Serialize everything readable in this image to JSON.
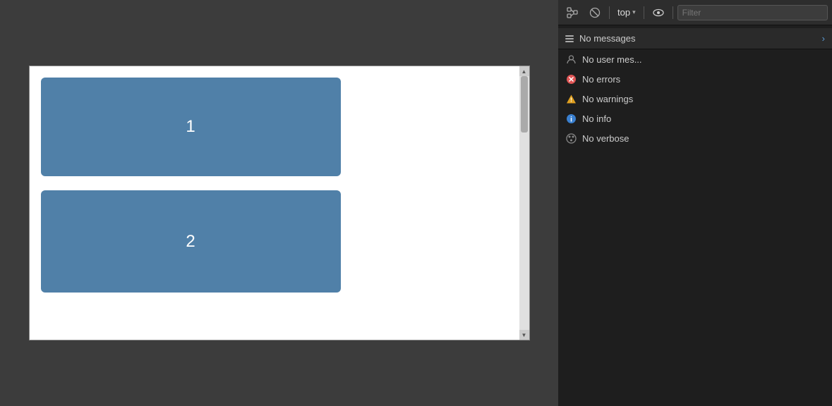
{
  "toolbar": {
    "top_label": "top",
    "filter_placeholder": "Filter",
    "chevron": "▾"
  },
  "messages": {
    "no_messages_label": "No messages",
    "items": [
      {
        "id": "user",
        "label": "No user mes...",
        "icon": "user"
      },
      {
        "id": "error",
        "label": "No errors",
        "icon": "error"
      },
      {
        "id": "warning",
        "label": "No warnings",
        "icon": "warning"
      },
      {
        "id": "info",
        "label": "No info",
        "icon": "info"
      },
      {
        "id": "verbose",
        "label": "No verbose",
        "icon": "verbose"
      }
    ]
  },
  "canvas": {
    "box1_label": "1",
    "box2_label": "2"
  }
}
